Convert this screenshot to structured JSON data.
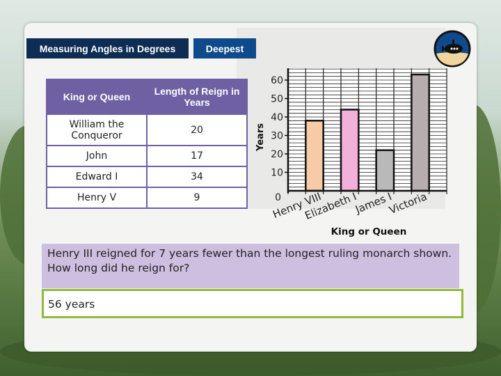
{
  "header": {
    "lesson_title": "Measuring Angles in Degrees",
    "level_label": "Deepest",
    "badge_icon": "submarine-icon"
  },
  "table": {
    "headers": [
      "King or Queen",
      "Length of Reign in Years"
    ],
    "rows": [
      [
        "William the Conqueror",
        "20"
      ],
      [
        "John",
        "17"
      ],
      [
        "Edward I",
        "34"
      ],
      [
        "Henry V",
        "9"
      ]
    ]
  },
  "chart_data": {
    "type": "bar",
    "categories": [
      "Henry VIII",
      "Elizabeth I",
      "James I",
      "Victoria"
    ],
    "values": [
      38,
      44,
      22,
      63
    ],
    "xlabel": "King or Queen",
    "ylabel": "Years",
    "ylim": [
      0,
      66
    ],
    "yticks": [
      0,
      10,
      20,
      30,
      40,
      50,
      60
    ],
    "grid": true,
    "colors": [
      "#f8cba8",
      "#f3b0d8",
      "#b9b9b9",
      "#b8adae"
    ]
  },
  "question": {
    "text": "Henry III reigned for 7 years fewer than the longest ruling monarch shown. How long did he reign for?"
  },
  "answer": {
    "value": "56 years"
  },
  "colors": {
    "navy": "#0e2d55",
    "blue": "#0f4a8c",
    "purple": "#6f5fa3",
    "lilac": "#cdbfe0",
    "green_border": "#8fba3c"
  }
}
